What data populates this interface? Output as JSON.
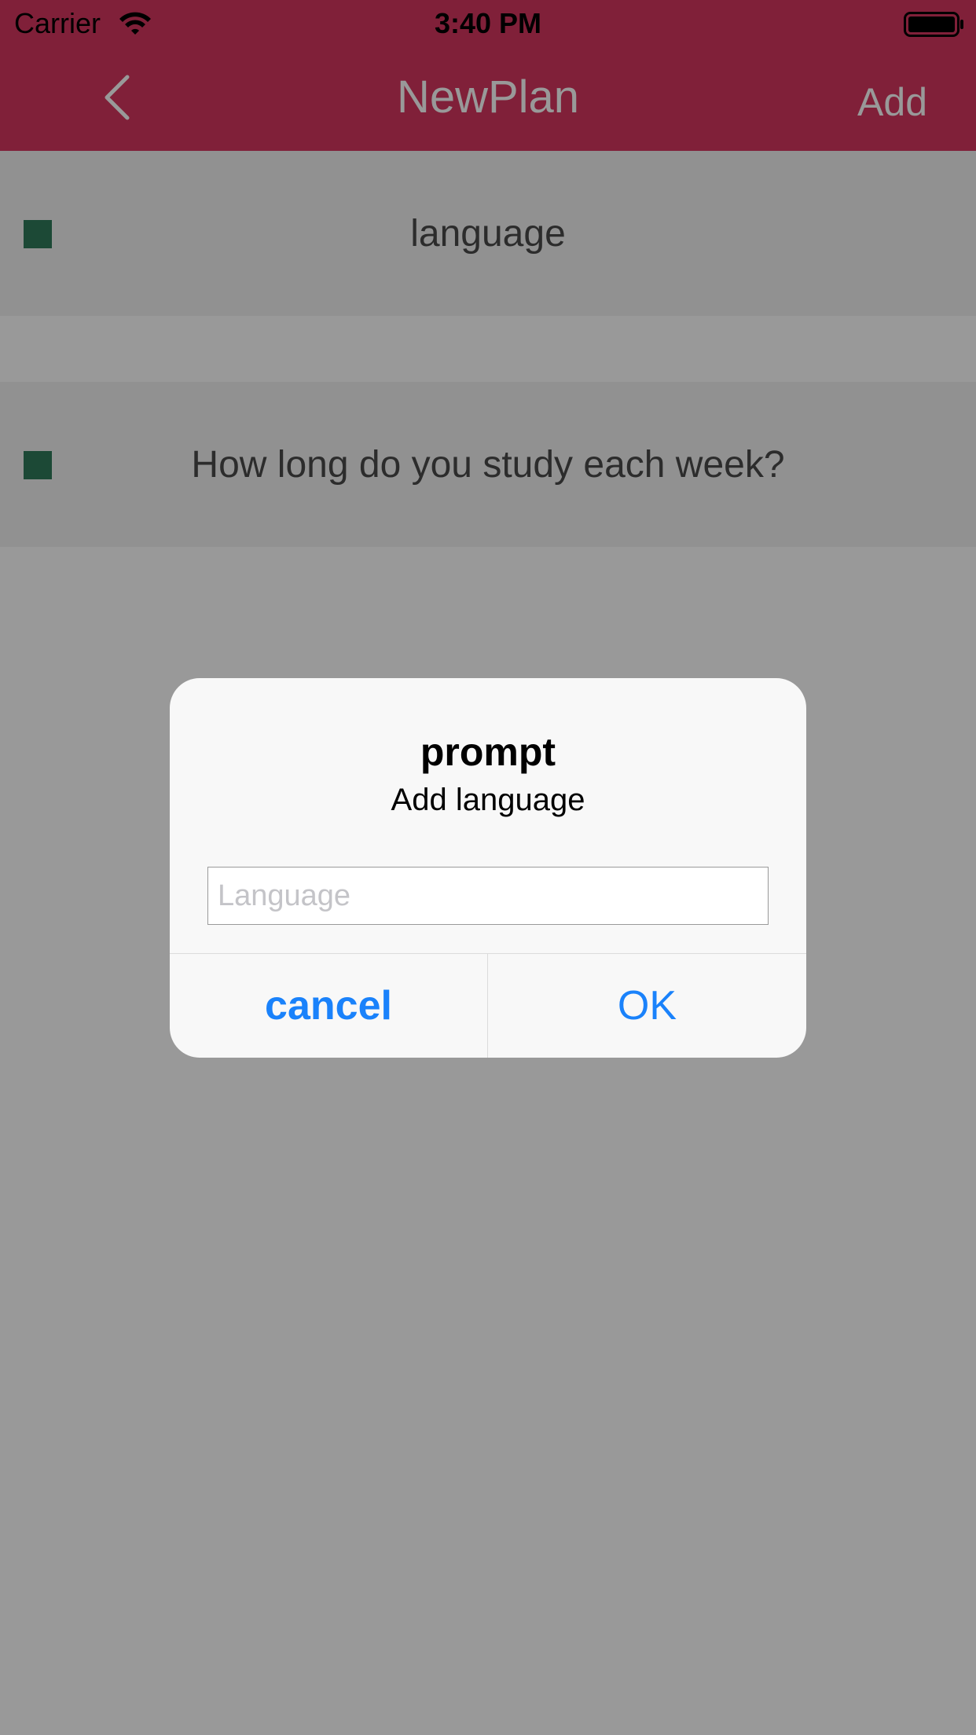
{
  "status_bar": {
    "carrier": "Carrier",
    "time": "3:40 PM",
    "wifi_icon": "wifi-icon",
    "battery_icon": "battery-full-icon"
  },
  "nav": {
    "back_icon": "chevron-left-icon",
    "title": "NewPlan",
    "add_label": "Add",
    "color": "#d6365f"
  },
  "list": {
    "rows": [
      {
        "label": "language",
        "marker_color": "#2f7a5a"
      },
      {
        "label": "How long do you study each week?",
        "marker_color": "#2f7a5a"
      }
    ]
  },
  "dialog": {
    "title": "prompt",
    "message": "Add language",
    "input_value": "",
    "input_placeholder": "Language",
    "cancel_label": "cancel",
    "ok_label": "OK",
    "button_color": "#1a82fb"
  }
}
